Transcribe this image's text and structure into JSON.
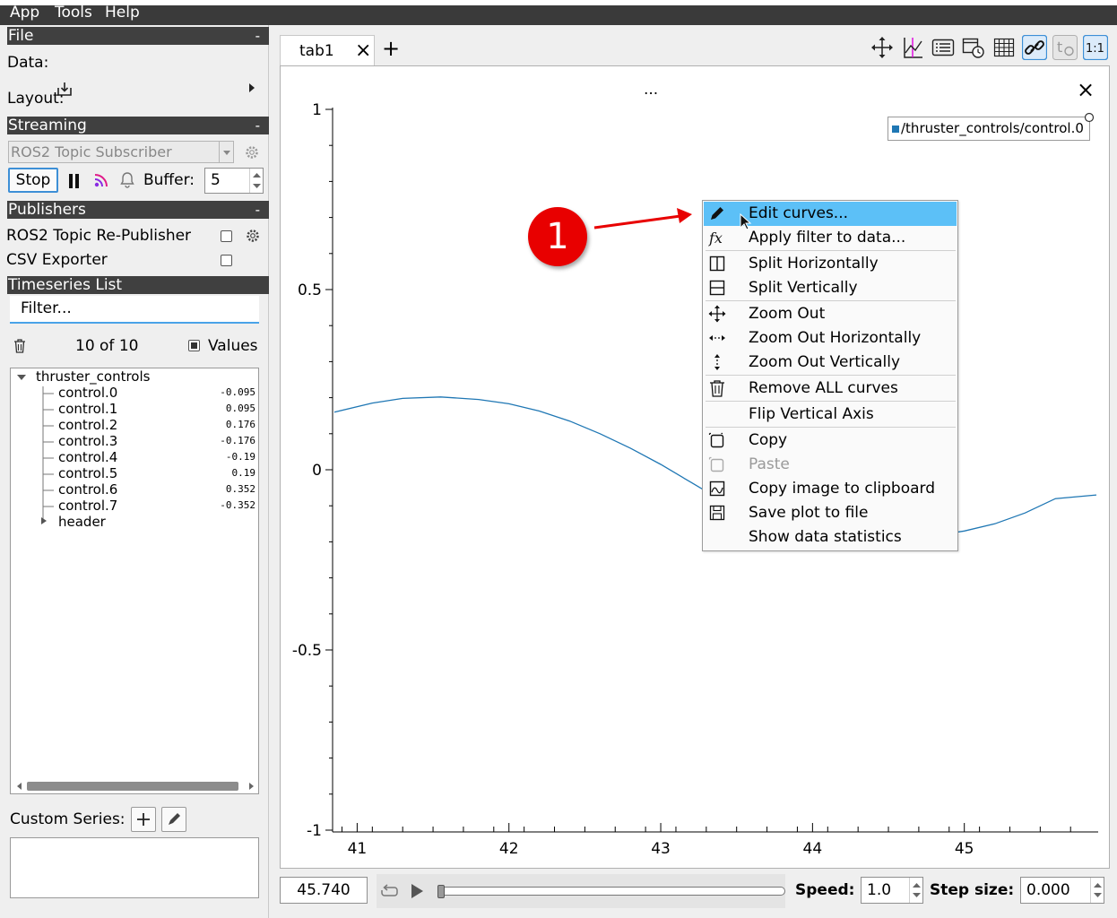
{
  "menubar": {
    "items": [
      "App",
      "Tools",
      "Help"
    ]
  },
  "sections": {
    "file": "File",
    "streaming": "Streaming",
    "publishers": "Publishers",
    "timeseries": "Timeseries List",
    "collapse": "-"
  },
  "file": {
    "data_label": "Data:",
    "layout_label": "Layout:"
  },
  "streaming": {
    "source": "ROS2 Topic Subscriber",
    "stop_label": "Stop",
    "buffer_label": "Buffer:",
    "buffer_value": "5"
  },
  "publishers": [
    {
      "name": "ROS2 Topic Re-Publisher",
      "checked": false
    },
    {
      "name": "CSV Exporter",
      "checked": false
    }
  ],
  "timeseries": {
    "filter_placeholder": "Filter...",
    "count": "10 of 10",
    "values_label": "Values",
    "tree": {
      "root": "thruster_controls",
      "children": [
        {
          "name": "control.0",
          "value": "-0.095"
        },
        {
          "name": "control.1",
          "value": "0.095"
        },
        {
          "name": "control.2",
          "value": "0.176"
        },
        {
          "name": "control.3",
          "value": "-0.176"
        },
        {
          "name": "control.4",
          "value": "-0.19"
        },
        {
          "name": "control.5",
          "value": "0.19"
        },
        {
          "name": "control.6",
          "value": "0.352"
        },
        {
          "name": "control.7",
          "value": "-0.352"
        }
      ],
      "collapsed": "header"
    }
  },
  "custom_series": {
    "label": "Custom Series:"
  },
  "tabs": {
    "active": "tab1",
    "close": "×",
    "add": "+"
  },
  "plot": {
    "title": "...",
    "close": "×",
    "legend": "/thruster_controls/control.0",
    "x_ticks": [
      "41",
      "42",
      "43",
      "44",
      "45"
    ],
    "y_ticks": [
      "1",
      "0.5",
      "0",
      "-0.5",
      "-1"
    ]
  },
  "chart_data": {
    "type": "line",
    "title": "...",
    "xlabel": "",
    "ylabel": "",
    "xlim": [
      40.85,
      45.87
    ],
    "ylim": [
      -1,
      1
    ],
    "grid": false,
    "legend": "top-right",
    "series": [
      {
        "name": "/thruster_controls/control.0",
        "color": "#1f77b4",
        "x": [
          40.85,
          41.1,
          41.3,
          41.55,
          41.8,
          42.0,
          42.2,
          42.4,
          42.6,
          42.8,
          43.0,
          43.2,
          43.4,
          43.6,
          43.8,
          44.0,
          44.2,
          44.4,
          44.6,
          44.8,
          45.0,
          45.2,
          45.4,
          45.6,
          45.87
        ],
        "y": [
          0.16,
          0.185,
          0.198,
          0.202,
          0.195,
          0.183,
          0.163,
          0.135,
          0.1,
          0.06,
          0.015,
          -0.035,
          -0.085,
          -0.13,
          -0.165,
          -0.195,
          -0.203,
          -0.202,
          -0.193,
          -0.183,
          -0.17,
          -0.15,
          -0.12,
          -0.08,
          -0.07
        ]
      }
    ]
  },
  "context_menu": {
    "items": [
      {
        "label": "Edit curves...",
        "icon": "pencil-icon",
        "active": true
      },
      {
        "label": "Apply filter to data...",
        "icon": "fx-icon"
      },
      {
        "label": "Split Horizontally",
        "icon": "split-horizontal-icon"
      },
      {
        "label": "Split Vertically",
        "icon": "split-vertical-icon"
      },
      {
        "label": "Zoom Out",
        "icon": "move-arrows-icon"
      },
      {
        "label": "Zoom Out Horizontally",
        "icon": "horizontal-arrows-icon"
      },
      {
        "label": "Zoom Out Vertically",
        "icon": "vertical-arrows-icon"
      },
      {
        "label": "Remove ALL curves",
        "icon": "trash-icon"
      },
      {
        "label": "Flip Vertical Axis",
        "icon": ""
      },
      {
        "label": "Copy",
        "icon": "copy-icon"
      },
      {
        "label": "Paste",
        "icon": "paste-icon",
        "disabled": true
      },
      {
        "label": "Copy image to clipboard",
        "icon": "image-icon"
      },
      {
        "label": "Save plot to file",
        "icon": "save-icon"
      },
      {
        "label": "Show data statistics",
        "icon": ""
      }
    ]
  },
  "annotation": {
    "number": "1",
    "color": "#e80000"
  },
  "playback": {
    "time": "45.740",
    "speed_label": "Speed:",
    "speed_value": "1.0",
    "step_label": "Step size:",
    "step_value": "0.000",
    "progress": 0.0
  },
  "colors": {
    "accent": "#5cc0f7",
    "curve": "#1f77b4",
    "section_header": "#404040"
  }
}
